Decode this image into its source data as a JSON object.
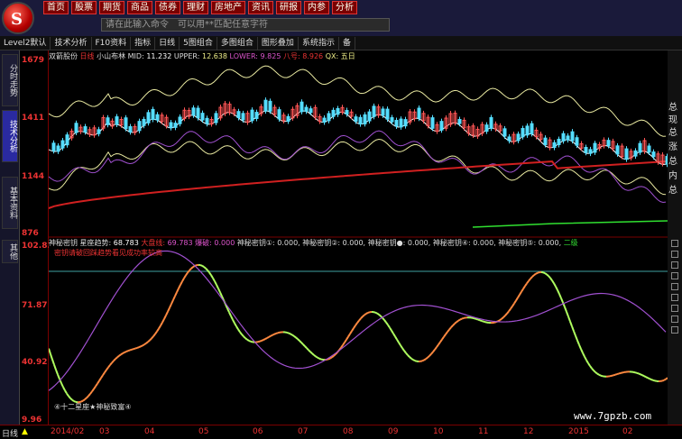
{
  "logo": {
    "glyph": "S"
  },
  "menu": [
    {
      "label": "首页"
    },
    {
      "label": "股票"
    },
    {
      "label": "期货"
    },
    {
      "label": "商品"
    },
    {
      "label": "债券"
    },
    {
      "label": "理财"
    },
    {
      "label": "房地产"
    },
    {
      "label": "资讯"
    },
    {
      "label": "研报"
    },
    {
      "label": "内参"
    },
    {
      "label": "分析"
    }
  ],
  "command": {
    "placeholder": "请在此输入命令　可以用**匹配任意字符"
  },
  "toolbar": [
    {
      "label": "Level2默认"
    },
    {
      "label": "技术分析"
    },
    {
      "label": "F10资料"
    },
    {
      "label": "指标"
    },
    {
      "label": "日线"
    },
    {
      "label": "5图组合"
    },
    {
      "label": "多图组合"
    },
    {
      "label": "图形叠加"
    },
    {
      "label": "系统指示"
    },
    {
      "label": "备"
    }
  ],
  "sidetabs": [
    {
      "label": "分时走势"
    },
    {
      "label": "技术分析"
    },
    {
      "label": "基本资料"
    },
    {
      "label": "其他"
    }
  ],
  "upper_info": {
    "stock": "双箭股份",
    "period": "日线",
    "indicator": "小山布林",
    "mid_label": "MID:",
    "mid": "11.232",
    "upper_label": "UPPER:",
    "upper": "12.638",
    "lower_label": "LOWER:",
    "lower": "9.825",
    "ba_label": "八号:",
    "ba": "8.926",
    "qx_label": "QX:",
    "wu": "五日"
  },
  "upper_y": [
    "1679",
    "1411",
    "1144",
    "876"
  ],
  "lower_info": {
    "name": "神秘密钥",
    "trend_label": "星座趋势:",
    "trend": "68.783",
    "dapan_label": "大盘线:",
    "dapan": "69.783",
    "chuizhi_label": "爆破:",
    "chuizhi": "0.000",
    "key1": "神秘密钥①: 0.000,",
    "key2": "神秘密钥②: 0.000,",
    "key3": "神秘密钥●: 0.000,",
    "key4": "神秘密钥④: 0.000,",
    "key5": "神秘密钥⑤: 0.000,",
    "er": "二级",
    "line2": "密钥请破回踩趋势看见成功率较高"
  },
  "lower_y": [
    "102.83",
    "71.87",
    "40.92",
    "9.96"
  ],
  "star_label": "④十二星座★神秘致富④",
  "bottom": {
    "period": "日线",
    "dates": [
      "2014/02",
      "03",
      "04",
      "05",
      "06",
      "07",
      "08",
      "09",
      "10",
      "11",
      "12",
      "2015",
      "02"
    ]
  },
  "right_panel": [
    "总",
    "现",
    "总",
    "涨",
    "总",
    "内",
    "总"
  ],
  "watermark": "www.7gpzb.com",
  "colors": {
    "up": "#ff5555",
    "down": "#55ddff",
    "boll": "#e8e8a0",
    "boll_mid": "#ffffff",
    "purple": "#a050d0",
    "ma_red": "#d02020",
    "green": "#30e030",
    "orange": "#ff8a40",
    "lightgreen": "#b0ff60",
    "cyanline": "#40a0a0"
  },
  "chart_data": [
    {
      "type": "candlestick",
      "title": "小山布林",
      "ylim": [
        876,
        1679
      ]
    },
    {
      "type": "line",
      "title": "神秘密钥",
      "ylim": [
        9.96,
        102.83
      ]
    }
  ]
}
